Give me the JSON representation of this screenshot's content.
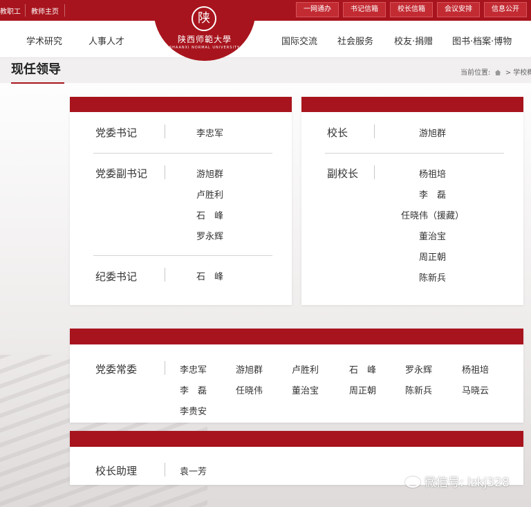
{
  "topbar": {
    "links": [
      "教职工",
      "教师主页"
    ],
    "buttons": [
      "一网通办",
      "书记信箱",
      "校长信箱",
      "会议安排",
      "信息公开"
    ]
  },
  "nav": {
    "left": [
      "学术研究",
      "人事人才"
    ],
    "right": [
      "国际交流",
      "社会服务",
      "校友·捐赠",
      "图书·档案·博物"
    ]
  },
  "logo": {
    "seal": "陕",
    "cn": "陕西师範大學",
    "en": "SHAANXI NORMAL UNIVERSITY"
  },
  "page": {
    "title": "现任领导",
    "breadcrumb_prefix": "当前位置:",
    "breadcrumb_tail": "> 学校概"
  },
  "party_card": {
    "secretary_label": "党委书记",
    "secretary": "李忠军",
    "deputy_label": "党委副书记",
    "deputies": [
      "游旭群",
      "卢胜利",
      "石　峰",
      "罗永辉"
    ],
    "discipline_label": "纪委书记",
    "discipline": "石　峰"
  },
  "president_card": {
    "president_label": "校长",
    "president": "游旭群",
    "vice_label": "副校长",
    "vices": [
      "杨祖培",
      "李　磊",
      "任晓伟（援藏）",
      "董治宝",
      "周正朝",
      "陈新兵"
    ]
  },
  "standing_card": {
    "label": "党委常委",
    "members": [
      "李忠军",
      "游旭群",
      "卢胜利",
      "石　峰",
      "罗永辉",
      "杨祖培",
      "李　磊",
      "任晓伟",
      "董治宝",
      "周正朝",
      "陈新兵",
      "马晓云",
      "李贵安"
    ]
  },
  "assistant_card": {
    "label": "校长助理",
    "name": "袁一芳"
  },
  "watermark": "微信号: lzkj328"
}
